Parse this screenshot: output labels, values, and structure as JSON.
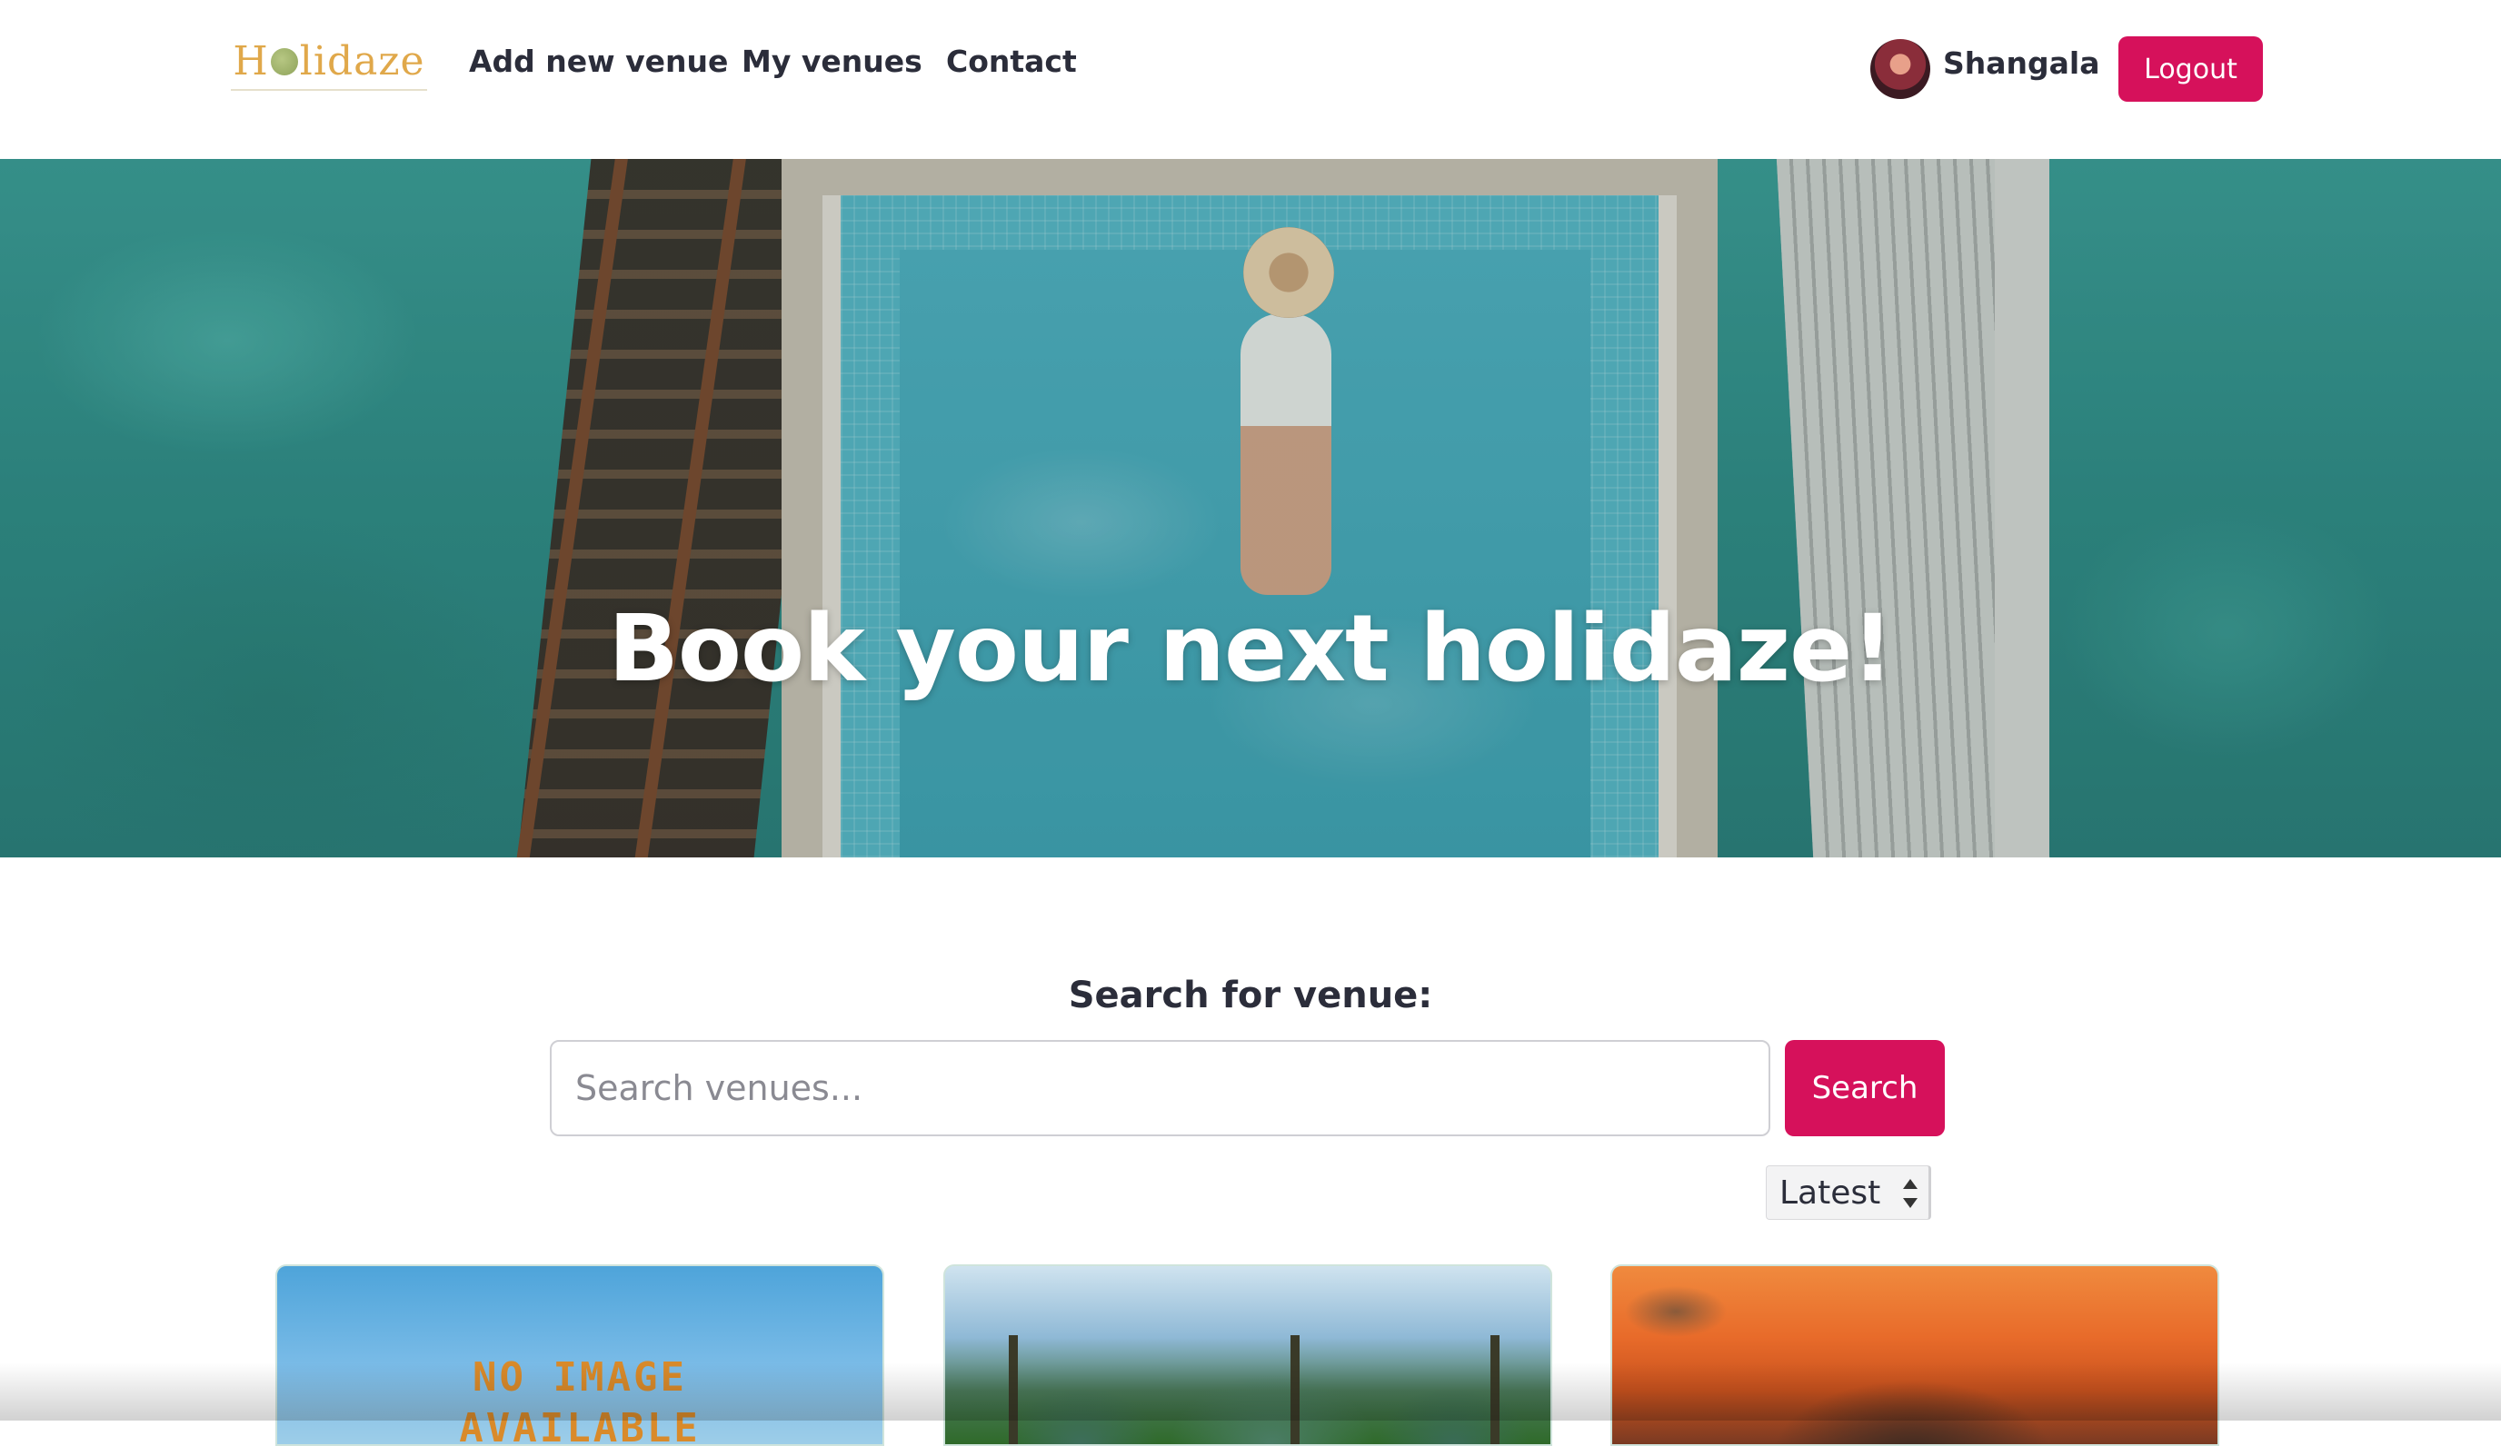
{
  "nav": {
    "logo_text_before": "H",
    "logo_text_after": "lidaze",
    "links": [
      "Add new venue",
      "My venues",
      "Contact"
    ],
    "username": "Shangala",
    "logout_label": "Logout"
  },
  "hero": {
    "title": "Book your next holidaze!"
  },
  "search": {
    "title": "Search for venue:",
    "placeholder": "Search venues...",
    "button_label": "Search",
    "sort_selected": "Latest"
  },
  "cards": [
    {
      "image": "no-image-placeholder",
      "placeholder_text_line1": "NO IMAGE",
      "placeholder_text_line2": "AVAILABLE"
    },
    {
      "image": "tropical-mountains-photo"
    },
    {
      "image": "fantasy-sunset-artwork"
    }
  ],
  "colors": {
    "accent": "#d6115b",
    "text": "#2b2d3a",
    "logo": "#e0a84a"
  }
}
